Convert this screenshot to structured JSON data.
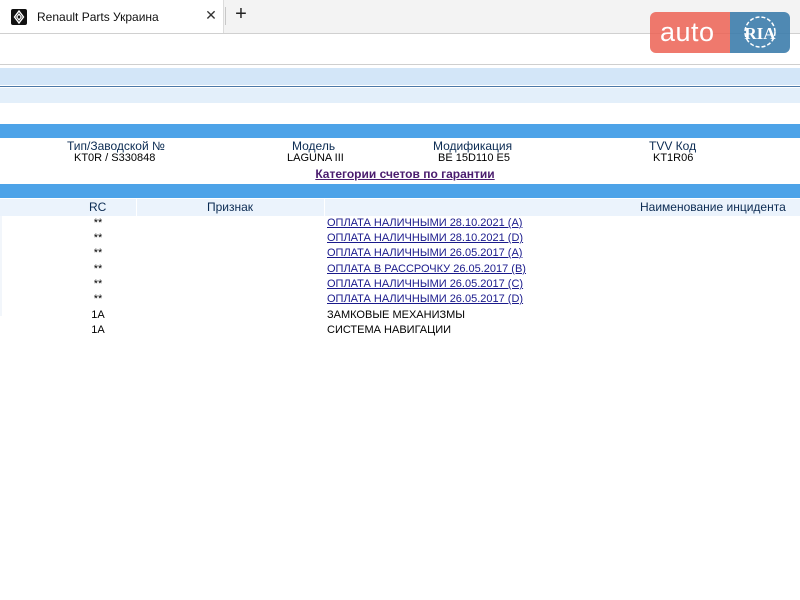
{
  "browser": {
    "tab_title": "Renault Parts Украина",
    "tab_close": "✕",
    "new_tab": "+"
  },
  "watermark": {
    "auto": "auto",
    "ria": "RIA"
  },
  "vehicle": {
    "headers": [
      "Тип/Заводской №",
      "Модель",
      "Модификация",
      "TVV Код"
    ],
    "values": [
      "KT0R / S330848",
      "LAGUNA III",
      "BE 15D110 E5",
      "KT1R06"
    ]
  },
  "warranty_link": "Категории счетов по гарантии",
  "grid": {
    "columns": [
      "RC",
      "Признак",
      "Наименование инцидента"
    ],
    "rows": [
      {
        "rc": "**",
        "name": "ОПЛАТА НАЛИЧНЫМИ 28.10.2021 (A)",
        "link": true
      },
      {
        "rc": "**",
        "name": "ОПЛАТА НАЛИЧНЫМИ 28.10.2021 (D)",
        "link": true
      },
      {
        "rc": "**",
        "name": "ОПЛАТА НАЛИЧНЫМИ 26.05.2017 (A)",
        "link": true
      },
      {
        "rc": "**",
        "name": "ОПЛАТА В РАССРОЧКУ 26.05.2017 (B)",
        "link": true
      },
      {
        "rc": "**",
        "name": "ОПЛАТА НАЛИЧНЫМИ 26.05.2017 (C)",
        "link": true
      },
      {
        "rc": "**",
        "name": "ОПЛАТА НАЛИЧНЫМИ 26.05.2017 (D)",
        "link": true
      },
      {
        "rc": "1A",
        "name": "ЗАМКОВЫЕ МЕХАНИЗМЫ",
        "link": false
      },
      {
        "rc": "1A",
        "name": "СИСТЕМА НАВИГАЦИИ",
        "link": false
      }
    ]
  },
  "colors": {
    "band_blue": "#4da3e8",
    "band_light": "#d3e6f8",
    "link": "#1a1a8c",
    "visited_link": "#4a1c6e",
    "header_text": "#0a2a52"
  },
  "icons": {
    "favicon": "renault-logo-icon",
    "close": "close-icon",
    "new_tab": "plus-icon"
  }
}
